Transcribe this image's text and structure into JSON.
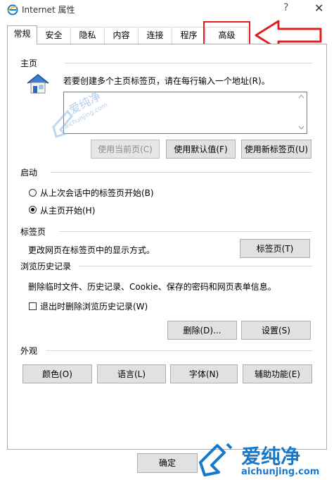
{
  "window": {
    "title": "Internet 属性",
    "help": "?",
    "close": "✕"
  },
  "tabs": [
    {
      "label": "常规",
      "active": true
    },
    {
      "label": "安全"
    },
    {
      "label": "隐私"
    },
    {
      "label": "内容"
    },
    {
      "label": "连接"
    },
    {
      "label": "程序"
    },
    {
      "label": "高级"
    }
  ],
  "home": {
    "section": "主页",
    "description": "若要创建多个主页标签页，请在每行输入一个地址(R)。",
    "use_current": "使用当前页(C)",
    "use_default": "使用默认值(F)",
    "use_new_tab": "使用新标签页(U)"
  },
  "startup": {
    "section": "启动",
    "option_last_session": "从上次会话中的标签页开始(B)",
    "option_home": "从主页开始(H)",
    "selected": "option_home"
  },
  "tabs_section": {
    "section": "标签页",
    "description": "更改网页在标签页中的显示方式。",
    "button": "标签页(T)"
  },
  "history": {
    "section": "浏览历史记录",
    "description": "删除临时文件、历史记录、Cookie、保存的密码和网页表单信息。",
    "delete_on_exit": "退出时删除浏览历史记录(W)",
    "delete_on_exit_checked": false,
    "delete_button": "删除(D)...",
    "settings_button": "设置(S)"
  },
  "appearance": {
    "section": "外观",
    "colors": "颜色(O)",
    "languages": "语言(L)",
    "fonts": "字体(N)",
    "accessibility": "辅助功能(E)"
  },
  "footer": {
    "ok": "确定"
  },
  "watermark": {
    "small_text": "爱纯净",
    "small_url": "aichunjing.com",
    "big_text": "爱纯净",
    "big_url": "aichunjing.com"
  },
  "colors": {
    "annotation_red": "#e02020",
    "accent_blue": "#1a78c8"
  }
}
